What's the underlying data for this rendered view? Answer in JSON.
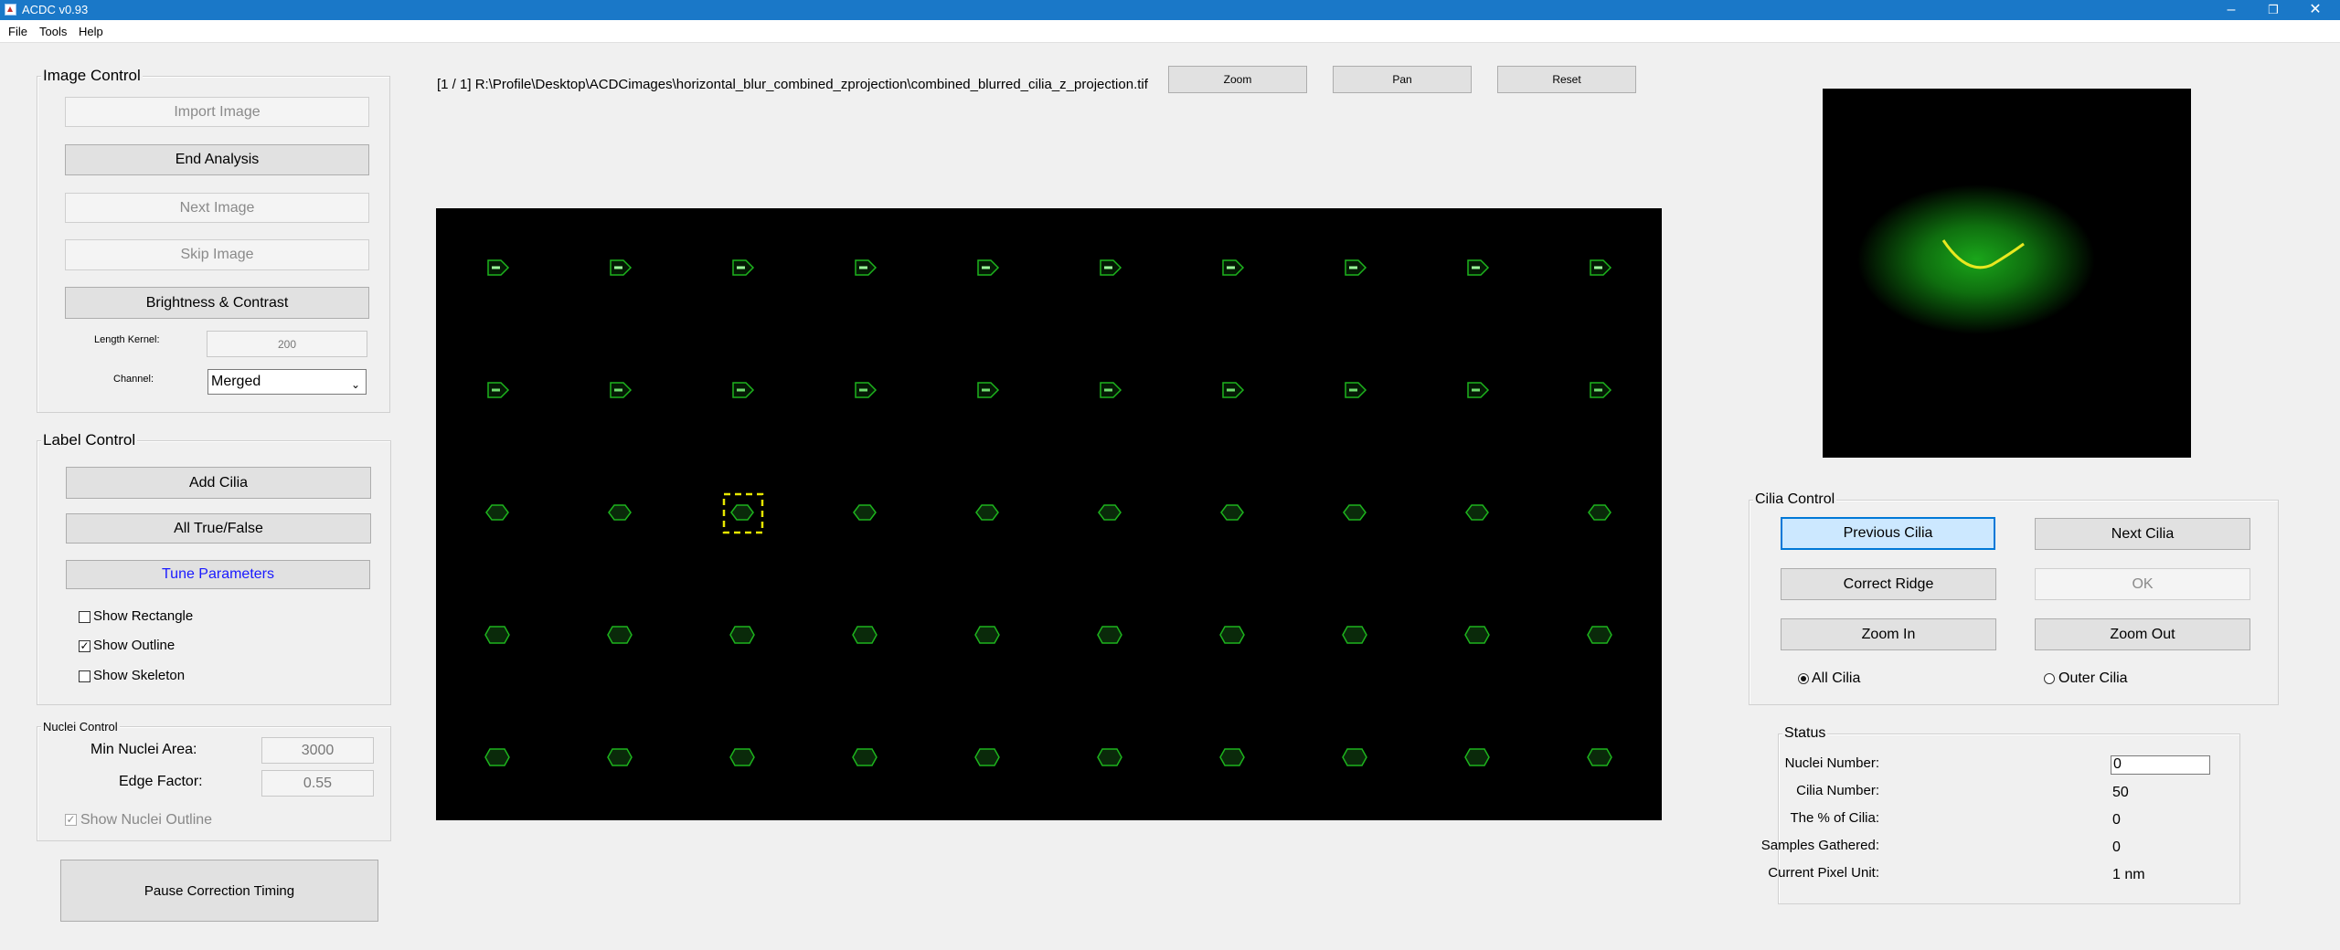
{
  "window": {
    "title": "ACDC v0.93",
    "minimize_icon": "minimize-icon",
    "maximize_icon": "restore-icon",
    "close_icon": "close-icon"
  },
  "menu": [
    "File",
    "Tools",
    "Help"
  ],
  "file_path": "[1 / 1] R:\\Profile\\Desktop\\ACDCimages\\horizontal_blur_combined_zprojection\\combined_blurred_cilia_z_projection.tif",
  "toolbar": {
    "zoom": "Zoom",
    "pan": "Pan",
    "reset": "Reset"
  },
  "image_control": {
    "title": "Image Control",
    "import": "Import Image",
    "end": "End Analysis",
    "next": "Next Image",
    "skip": "Skip Image",
    "brightness": "Brightness & Contrast",
    "length_kernel_label": "Length Kernel:",
    "length_kernel_value": "200",
    "channel_label": "Channel:",
    "channel_value": "Merged"
  },
  "label_control": {
    "title": "Label Control",
    "add": "Add Cilia",
    "all_true_false": "All True/False",
    "tune": "Tune Parameters",
    "show_rectangle": "Show Rectangle",
    "show_outline": "Show Outline",
    "show_skeleton": "Show Skeleton",
    "show_rectangle_checked": false,
    "show_outline_checked": true,
    "show_skeleton_checked": false
  },
  "nuclei_control": {
    "title": "Nuclei Control",
    "min_area_label": "Min Nuclei Area:",
    "min_area_value": "3000",
    "edge_factor_label": "Edge Factor:",
    "edge_factor_value": "0.55",
    "show_outline": "Show Nuclei Outline",
    "show_outline_checked": true
  },
  "pause_button": "Pause Correction Timing",
  "cilia_control": {
    "title": "Cilia Control",
    "previous": "Previous Cilia",
    "next": "Next Cilia",
    "correct_ridge": "Correct Ridge",
    "ok": "OK",
    "zoom_in": "Zoom In",
    "zoom_out": "Zoom Out",
    "all_cilia": "All Cilia",
    "outer_cilia": "Outer Cilia",
    "selected_filter": "All Cilia"
  },
  "status": {
    "title": "Status",
    "nuclei_label": "Nuclei Number:",
    "nuclei_value": "0",
    "cilia_label": "Cilia Number:",
    "cilia_value": "50",
    "percent_label": "The % of Cilia:",
    "percent_value": "0",
    "samples_label": "Samples Gathered:",
    "samples_value": "0",
    "pixel_unit_label": "Current Pixel Unit:",
    "pixel_unit_value": "1 nm"
  },
  "grid": {
    "rows": 5,
    "cols": 10,
    "selected_row": 2,
    "selected_col": 2
  },
  "colors": {
    "cilia_outline": "#1db31d",
    "selection": "#e6e600",
    "accent": "#0078d7",
    "titlebar": "#1a78c8"
  }
}
